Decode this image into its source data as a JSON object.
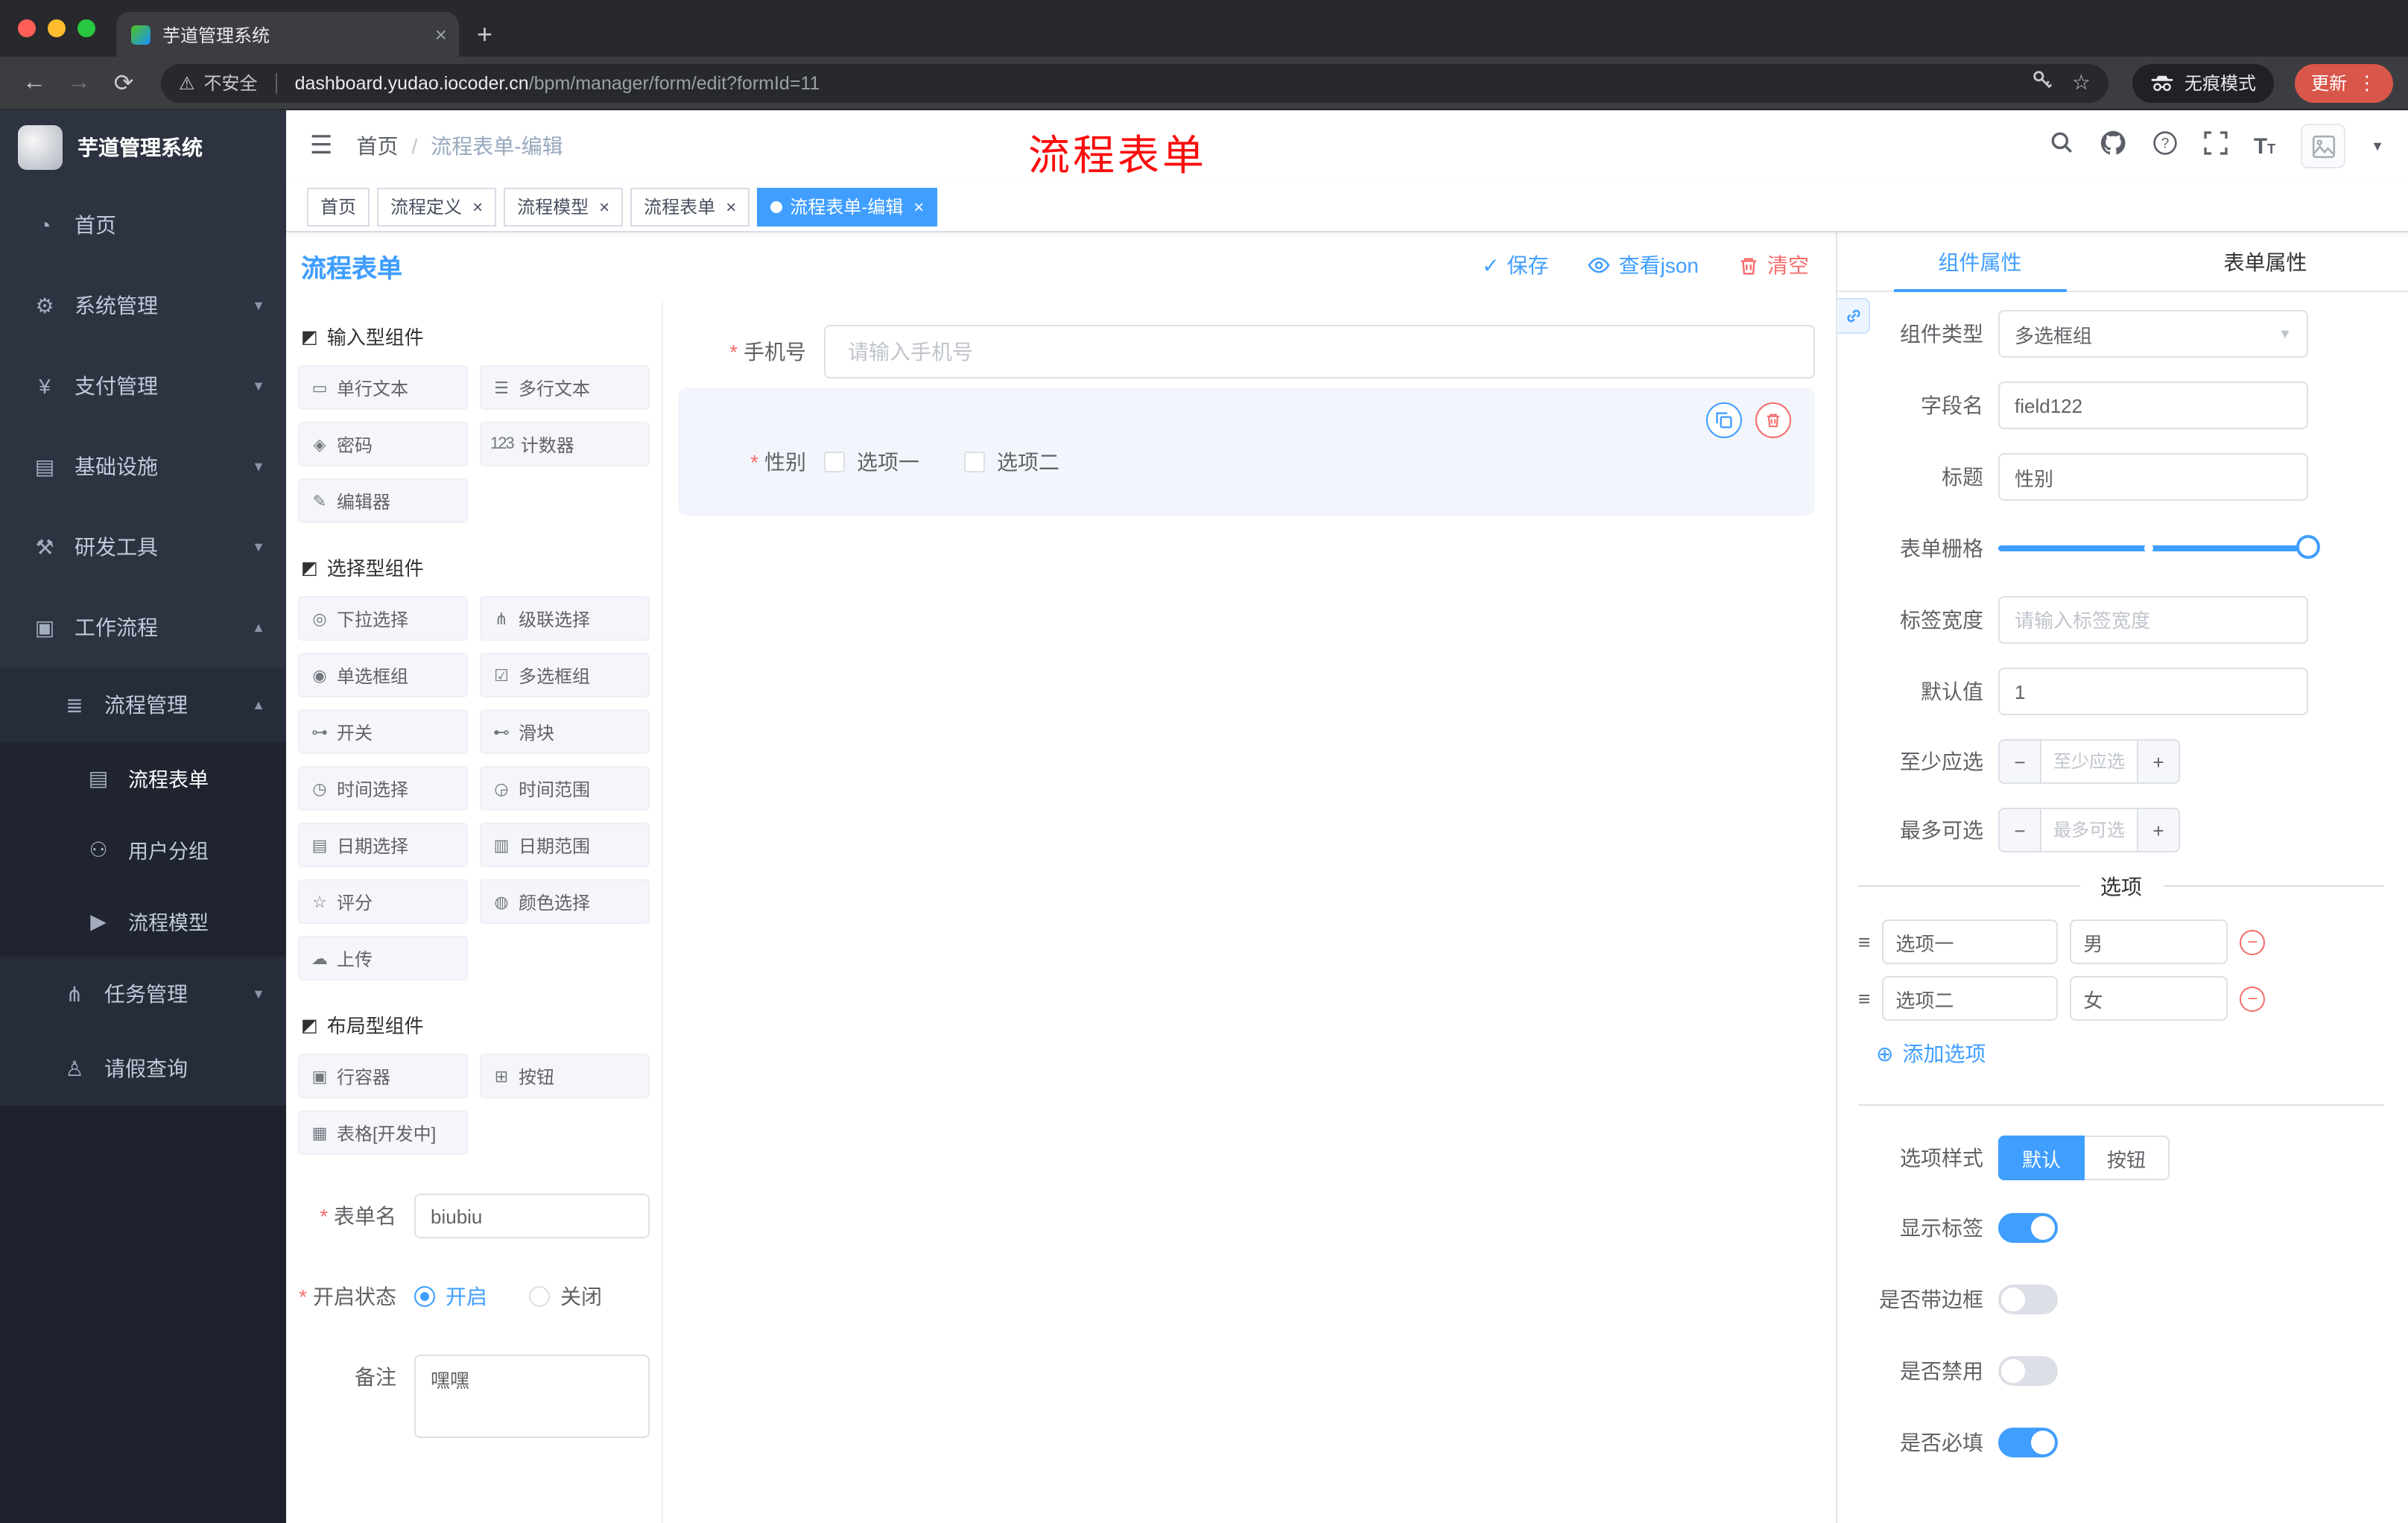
{
  "colors": {
    "accent": "#409EFF",
    "danger": "#F56C6C",
    "annotation": "#FD0D0D",
    "sidebar_bg": "#2D3341",
    "active_tag_bg": "#409EFF"
  },
  "browser": {
    "tab_title": "芋道管理系统",
    "security_label": "不安全",
    "url_domain": "dashboard.yudao.iocoder.cn",
    "url_path": "/bpm/manager/form/edit?formId=11",
    "incognito_label": "无痕模式",
    "update_label": "更新"
  },
  "sidebar": {
    "logo_title": "芋道管理系统",
    "items": [
      {
        "label": "首页",
        "icon": "◔"
      },
      {
        "label": "系统管理",
        "icon": "⚙"
      },
      {
        "label": "支付管理",
        "icon": "¥"
      },
      {
        "label": "基础设施",
        "icon": "▤"
      },
      {
        "label": "研发工具",
        "icon": "⚒"
      },
      {
        "label": "工作流程",
        "icon": "▣"
      },
      {
        "label": "流程管理",
        "icon": "≣"
      },
      {
        "label": "流程表单",
        "icon": "▤"
      },
      {
        "label": "用户分组",
        "icon": "⚇"
      },
      {
        "label": "流程模型",
        "icon": "▶"
      },
      {
        "label": "任务管理",
        "icon": "⋔"
      },
      {
        "label": "请假查询",
        "icon": "♙"
      }
    ]
  },
  "header": {
    "breadcrumb_home": "首页",
    "breadcrumb_current": "流程表单-编辑",
    "annotation": "流程表单"
  },
  "tags": [
    {
      "label": "首页"
    },
    {
      "label": "流程定义"
    },
    {
      "label": "流程模型"
    },
    {
      "label": "流程表单"
    },
    {
      "label": "流程表单-编辑"
    }
  ],
  "designer": {
    "title": "流程表单",
    "actions": {
      "save": "保存",
      "view_json": "查看json",
      "clear": "清空"
    },
    "palette": {
      "sections": [
        {
          "title": "输入型组件",
          "items": [
            {
              "label": "单行文本",
              "icon": "▭"
            },
            {
              "label": "多行文本",
              "icon": "☰"
            },
            {
              "label": "密码",
              "icon": "◈"
            },
            {
              "label": "计数器",
              "icon": "123"
            },
            {
              "label": "编辑器",
              "icon": "✎"
            }
          ]
        },
        {
          "title": "选择型组件",
          "items": [
            {
              "label": "下拉选择",
              "icon": "◎"
            },
            {
              "label": "级联选择",
              "icon": "⋔"
            },
            {
              "label": "单选框组",
              "icon": "◉"
            },
            {
              "label": "多选框组",
              "icon": "☑"
            },
            {
              "label": "开关",
              "icon": "⊶"
            },
            {
              "label": "滑块",
              "icon": "⊷"
            },
            {
              "label": "时间选择",
              "icon": "◷"
            },
            {
              "label": "时间范围",
              "icon": "◶"
            },
            {
              "label": "日期选择",
              "icon": "▤"
            },
            {
              "label": "日期范围",
              "icon": "▥"
            },
            {
              "label": "评分",
              "icon": "☆"
            },
            {
              "label": "颜色选择",
              "icon": "◍"
            },
            {
              "label": "上传",
              "icon": "☁"
            }
          ]
        },
        {
          "title": "布局型组件",
          "items": [
            {
              "label": "行容器",
              "icon": "▣"
            },
            {
              "label": "按钮",
              "icon": "⊞"
            },
            {
              "label": "表格[开发中]",
              "icon": "▦"
            }
          ]
        }
      ]
    },
    "meta_form": {
      "form_name_label": "表单名",
      "form_name_value": "biubiu",
      "status_label": "开启状态",
      "status_on": "开启",
      "status_off": "关闭",
      "remark_label": "备注",
      "remark_value": "嘿嘿"
    },
    "canvas": {
      "phone_label": "手机号",
      "phone_placeholder": "请输入手机号",
      "gender_label": "性别",
      "gender_options": [
        {
          "label": "选项一"
        },
        {
          "label": "选项二"
        }
      ]
    }
  },
  "properties": {
    "tab_component": "组件属性",
    "tab_form": "表单属性",
    "type_label": "组件类型",
    "type_value": "多选框组",
    "field_label": "字段名",
    "field_value": "field122",
    "title_label": "标题",
    "title_value": "性别",
    "grid_label": "表单栅格",
    "label_width_label": "标签宽度",
    "label_width_placeholder": "请输入标签宽度",
    "default_label": "默认值",
    "default_value": "1",
    "min_label": "至少应选",
    "min_placeholder": "至少应选",
    "max_label": "最多可选",
    "max_placeholder": "最多可选",
    "options_divider": "选项",
    "options": [
      {
        "name": "选项一",
        "value": "男"
      },
      {
        "name": "选项二",
        "value": "女"
      }
    ],
    "add_option_label": "添加选项",
    "style_label": "选项样式",
    "style_default": "默认",
    "style_button": "按钮",
    "switches": [
      {
        "label": "显示标签",
        "on": true
      },
      {
        "label": "是否带边框",
        "on": false
      },
      {
        "label": "是否禁用",
        "on": false
      },
      {
        "label": "是否必填",
        "on": true
      }
    ]
  }
}
